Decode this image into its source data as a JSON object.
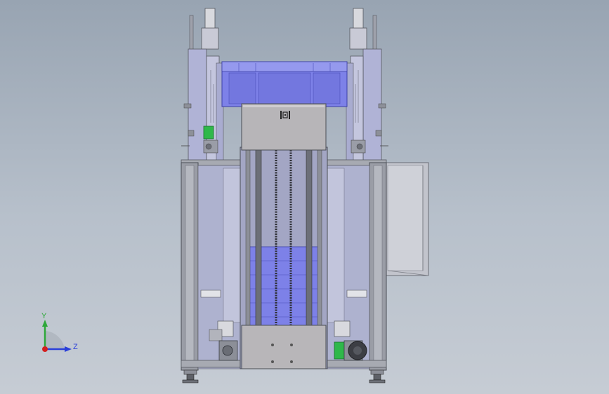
{
  "triad": {
    "y_label": "Y",
    "z_label": "Z",
    "x_label": ""
  },
  "colors": {
    "frame": "#8f949e",
    "frame_dark": "#55585f",
    "panel_light": "#c4c7d3",
    "lavender": "#aeb2d4",
    "bin_blue": "#7b7fe6",
    "bin_blue_dark": "#5c60c8",
    "gray_panel": "#b8b8bc",
    "green_part": "#2fb84a",
    "axis_y": "#2ea83a",
    "axis_z": "#2a3fd9",
    "axis_origin": "#d32020"
  },
  "icons": [
    "lock-symbol-icon",
    "axis-triad-icon"
  ]
}
